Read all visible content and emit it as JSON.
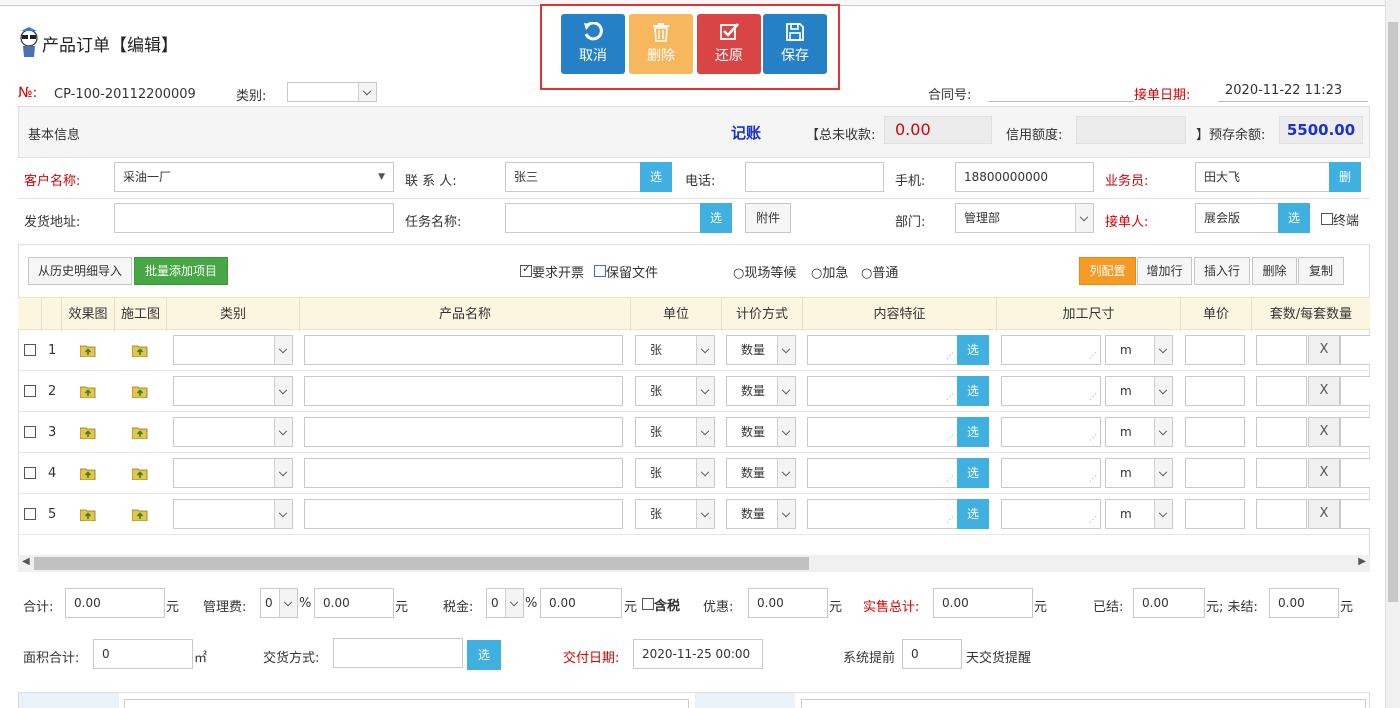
{
  "header": {
    "title": "产品订单【编辑】"
  },
  "toolbar": {
    "cancel": "取消",
    "delete": "删除",
    "restore": "还原",
    "save": "保存"
  },
  "order": {
    "no_label": "№:",
    "no": "CP-100-20112200009",
    "category_label": "类别:",
    "category": "",
    "contract_label": "合同号:",
    "contract": "",
    "date_label": "接单日期:",
    "date": "2020-11-22 11:23"
  },
  "basic": {
    "title": "基本信息",
    "bookkeeping": "记账",
    "unpaid_label": "【总未收款:",
    "unpaid": "0.00",
    "credit_label": "信用额度:",
    "credit": "",
    "prepaid_label": "】预存余额:",
    "prepaid": "5500.00"
  },
  "customer": {
    "name_label": "客户名称:",
    "name": "采油一厂",
    "contact_label": "联 系 人:",
    "contact": "张三",
    "phone_label": "电话:",
    "phone": "",
    "mobile_label": "手机:",
    "mobile": "18800000000",
    "sales_label": "业务员:",
    "sales": "田大飞",
    "sales_btn": "删",
    "address_label": "发货地址:",
    "address": "",
    "task_label": "任务名称:",
    "task": "",
    "attach_btn": "附件",
    "dept_label": "部门:",
    "dept": "管理部",
    "receiver_label": "接单人:",
    "receiver": "展会版",
    "terminal": "终端",
    "select_btn": "选"
  },
  "table_toolbar": {
    "history_import": "从历史明细导入",
    "batch_add": "批量添加项目",
    "need_invoice": "要求开票",
    "keep_file": "保留文件",
    "onsite_wait": "现场等候",
    "urgent": "加急",
    "normal": "普通",
    "col_config": "列配置",
    "add_row": "增加行",
    "insert_row": "插入行",
    "delete": "删除",
    "copy": "复制"
  },
  "table": {
    "headers": [
      "效果图",
      "施工图",
      "类别",
      "产品名称",
      "单位",
      "计价方式",
      "内容特征",
      "加工尺寸",
      "单价",
      "套数/每套数量"
    ],
    "rows": [
      {
        "idx": "1",
        "unit": "张",
        "pricing": "数量",
        "size_unit": "m",
        "x": "X"
      },
      {
        "idx": "2",
        "unit": "张",
        "pricing": "数量",
        "size_unit": "m",
        "x": "X"
      },
      {
        "idx": "3",
        "unit": "张",
        "pricing": "数量",
        "size_unit": "m",
        "x": "X"
      },
      {
        "idx": "4",
        "unit": "张",
        "pricing": "数量",
        "size_unit": "m",
        "x": "X"
      },
      {
        "idx": "5",
        "unit": "张",
        "pricing": "数量",
        "size_unit": "m",
        "x": "X"
      }
    ],
    "select_btn": "选"
  },
  "totals": {
    "sum_label": "合计:",
    "sum": "0.00",
    "yuan": "元",
    "mgmt_label": "管理费:",
    "mgmt_pct": "0",
    "pct": "%",
    "mgmt": "0.00",
    "tax_label": "税金:",
    "tax_pct": "0",
    "tax": "0.00",
    "tax_incl": "含税",
    "discount_label": "优惠:",
    "discount": "0.00",
    "actual_label": "实售总计:",
    "actual": "0.00",
    "settled_label": "已结:",
    "settled": "0.00",
    "unsettled_label": "元; 未结:",
    "unsettled": "0.00",
    "area_label": "面积合计:",
    "area": "0",
    "area_unit": "㎡",
    "delivery_label": "交货方式:",
    "delivery": "",
    "select_btn": "选",
    "deliver_date_label": "交付日期:",
    "deliver_date": "2020-11-25 00:00",
    "remind_label": "系统提前",
    "remind_days": "0",
    "remind_suffix": "天交货提醒"
  }
}
